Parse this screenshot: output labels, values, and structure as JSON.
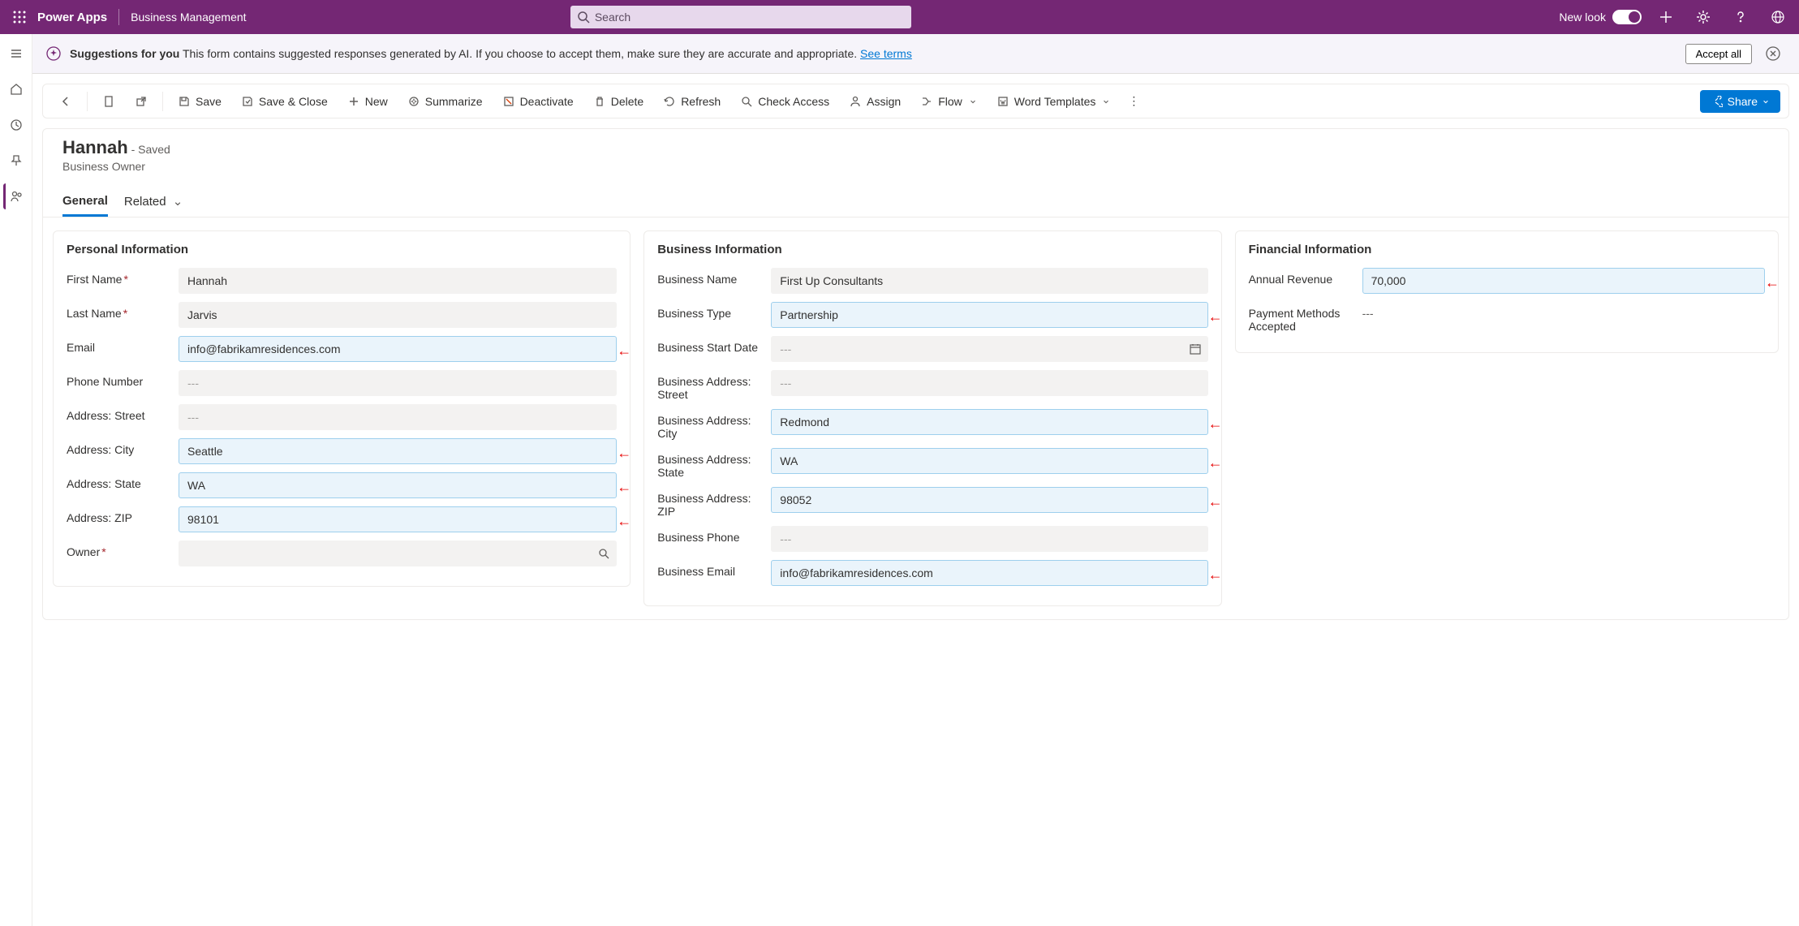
{
  "topbar": {
    "app_name": "Power Apps",
    "sub_label": "Business Management",
    "search_placeholder": "Search",
    "new_look_label": "New look"
  },
  "suggest": {
    "bold": "Suggestions for you",
    "text": "This form contains suggested responses generated by AI. If you choose to accept them, make sure they are accurate and appropriate.",
    "link": "See terms",
    "accept_all": "Accept all"
  },
  "cmd": {
    "save": "Save",
    "save_close": "Save & Close",
    "new": "New",
    "summarize": "Summarize",
    "deactivate": "Deactivate",
    "delete": "Delete",
    "refresh": "Refresh",
    "check_access": "Check Access",
    "assign": "Assign",
    "flow": "Flow",
    "word_templates": "Word Templates",
    "share": "Share"
  },
  "record": {
    "title": "Hannah",
    "saved": "- Saved",
    "entity": "Business Owner"
  },
  "tabs": {
    "general": "General",
    "related": "Related"
  },
  "sections": {
    "personal": {
      "title": "Personal Information",
      "first_name_label": "First Name",
      "first_name_value": "Hannah",
      "last_name_label": "Last Name",
      "last_name_value": "Jarvis",
      "email_label": "Email",
      "email_value": "info@fabrikamresidences.com",
      "phone_label": "Phone Number",
      "phone_value": "---",
      "street_label": "Address: Street",
      "street_value": "---",
      "city_label": "Address: City",
      "city_value": "Seattle",
      "state_label": "Address: State",
      "state_value": "WA",
      "zip_label": "Address: ZIP",
      "zip_value": "98101",
      "owner_label": "Owner",
      "owner_value": ""
    },
    "business": {
      "title": "Business Information",
      "name_label": "Business Name",
      "name_value": "First Up Consultants",
      "type_label": "Business Type",
      "type_value": "Partnership",
      "start_label": "Business Start Date",
      "start_value": "---",
      "street_label": "Business Address: Street",
      "street_value": "---",
      "city_label": "Business Address: City",
      "city_value": "Redmond",
      "state_label": "Business Address: State",
      "state_value": "WA",
      "zip_label": "Business Address: ZIP",
      "zip_value": "98052",
      "phone_label": "Business Phone",
      "phone_value": "---",
      "email_label": "Business Email",
      "email_value": "info@fabrikamresidences.com"
    },
    "financial": {
      "title": "Financial Information",
      "revenue_label": "Annual Revenue",
      "revenue_value": "70,000",
      "payment_label": "Payment Methods Accepted",
      "payment_value": "---"
    }
  }
}
